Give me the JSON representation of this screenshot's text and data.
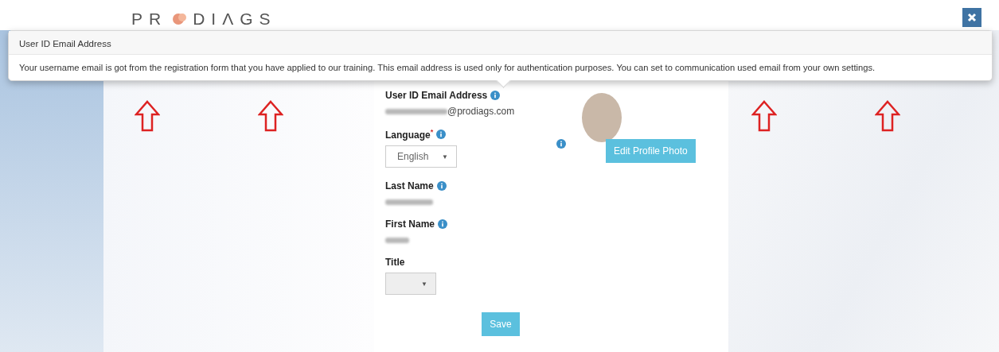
{
  "header": {
    "logo_start": "PR",
    "logo_end": "DIΛGS"
  },
  "tooltip": {
    "title": "User ID Email Address",
    "body": "Your username email is got from the registration form that you have applied to our training. This email address is used only for authentication purposes. You can set to communication used email from your own settings."
  },
  "form": {
    "fields": [
      {
        "kind": "text",
        "label": "User ID Email Address",
        "info": true,
        "value": "@prodiags.com",
        "blurred": true
      },
      {
        "kind": "select",
        "label": "Language",
        "required_mark": "*",
        "info": true,
        "value": "English",
        "caret": "▼",
        "disabled": false
      },
      {
        "kind": "text",
        "label": "Last Name",
        "info": true,
        "blurred": true
      },
      {
        "kind": "text",
        "label": "First Name",
        "info": true,
        "blurred": true
      },
      {
        "kind": "select",
        "label": "Title",
        "info": false,
        "caret": "▼",
        "disabled": true
      }
    ],
    "photo_button": "Edit Profile Photo",
    "save_button": "Save"
  },
  "annotations": [
    {
      "kind": "arrow"
    },
    {
      "kind": "arrow"
    },
    {
      "kind": "arrow"
    },
    {
      "kind": "arrow"
    }
  ]
}
